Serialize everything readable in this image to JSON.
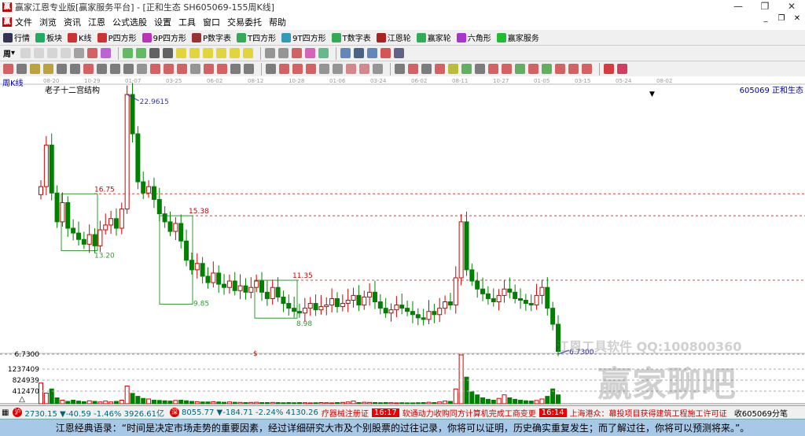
{
  "window": {
    "title": "赢家江恩专业版[赢家服务平台] - [正和生态  SH605069-155周K线]",
    "min": "—",
    "max": "❐",
    "close": "✕"
  },
  "menu": [
    "文件",
    "浏览",
    "资讯",
    "江恩",
    "公式选股",
    "设置",
    "工具",
    "窗口",
    "交易委托",
    "帮助"
  ],
  "toolbar1": [
    {
      "label": "行情",
      "color": "#335"
    },
    {
      "label": "板块",
      "color": "#2a6"
    },
    {
      "label": "K线",
      "color": "#c33"
    },
    {
      "label": "P四方形",
      "color": "#c33"
    },
    {
      "label": "9P四方形",
      "color": "#b3b"
    },
    {
      "label": "P数字表",
      "color": "#933"
    },
    {
      "label": "T四方形",
      "color": "#3a5"
    },
    {
      "label": "9T四方形",
      "color": "#39b"
    },
    {
      "label": "T数字表",
      "color": "#3a5"
    },
    {
      "label": "江恩轮",
      "color": "#a22"
    },
    {
      "label": "赢家轮",
      "color": "#3a5"
    },
    {
      "label": "六角形",
      "color": "#a3c"
    },
    {
      "label": "赢家服务",
      "color": "#2b3"
    }
  ],
  "toolbar2_period": "周",
  "chart_header": {
    "period": "周K线",
    "indicator": "老子十二宫结构",
    "stock": "605069  正和生态"
  },
  "chart_data": {
    "type": "candlestick",
    "title": "老子十二宫结构",
    "x_tick_labels": [
      "08-20",
      "10-29",
      "01-07",
      "03-25",
      "06-02",
      "08-12",
      "10-28",
      "01-06",
      "03-24",
      "06-02",
      "08-11",
      "10-27",
      "01-05",
      "03-15",
      "05-24",
      "08-02"
    ],
    "ylim": [
      6.0,
      23.5
    ],
    "closes": [
      17.2,
      19.8,
      16.8,
      15.0,
      16.2,
      14.6,
      14.3,
      13.9,
      13.6,
      14.2,
      13.5,
      14.5,
      14.8,
      15.2,
      14.6,
      15.8,
      22.96,
      20.5,
      17.5,
      16.8,
      17.2,
      16.4,
      15.5,
      15.0,
      14.4,
      14.9,
      13.8,
      12.6,
      12.0,
      12.4,
      11.6,
      11.2,
      11.8,
      11.1,
      10.9,
      11.3,
      10.7,
      11.0,
      10.6,
      10.9,
      11.3,
      10.6,
      10.2,
      10.9,
      10.3,
      9.9,
      9.6,
      9.4,
      9.3,
      9.6,
      9.9,
      9.5,
      9.7,
      9.8,
      10.2,
      9.7,
      9.9,
      10.1,
      10.4,
      9.8,
      10.3,
      10.6,
      10.0,
      9.6,
      9.3,
      9.5,
      9.8,
      9.6,
      9.4,
      9.2,
      9.0,
      8.9,
      9.4,
      9.2,
      9.6,
      10.0,
      9.8,
      11.5,
      15.0,
      12.0,
      11.3,
      10.8,
      10.5,
      10.2,
      10.0,
      10.4,
      10.8,
      10.6,
      10.2,
      10.1,
      9.9,
      9.8,
      10.4,
      10.9,
      9.6,
      8.6,
      6.9
    ],
    "volumes": [
      700000,
      360000,
      500000,
      200000,
      120000,
      80000,
      120000,
      90000,
      70000,
      100000,
      80000,
      60000,
      90000,
      60000,
      80000,
      120000,
      600000,
      350000,
      250000,
      180000,
      160000,
      120000,
      110000,
      100000,
      90000,
      110000,
      120000,
      100000,
      80000,
      70000,
      60000,
      60000,
      70000,
      60000,
      50000,
      60000,
      50000,
      45000,
      40000,
      45000,
      50000,
      40000,
      40000,
      45000,
      40000,
      35000,
      40000,
      35000,
      40000,
      35000,
      30000,
      35000,
      40000,
      35000,
      30000,
      40000,
      45000,
      60000,
      90000,
      40000,
      50000,
      45000,
      40000,
      35000,
      40000,
      35000,
      30000,
      35000,
      30000,
      30000,
      35000,
      40000,
      50000,
      40000,
      60000,
      90000,
      80000,
      500000,
      1650000,
      900000,
      400000,
      300000,
      200000,
      150000,
      120000,
      180000,
      300000,
      200000,
      150000,
      120000,
      100000,
      90000,
      110000,
      160000,
      250000,
      500000,
      300000
    ],
    "y_labels": {
      "price_low": "6.7300",
      "vol": [
        "1237409",
        "824939",
        "412470"
      ]
    },
    "annotations": {
      "high": "22.9615",
      "low": "6.7300",
      "levels": [
        "16.75",
        "13.20",
        "15.38",
        "9.85",
        "11.35",
        "8.98"
      ],
      "dollar": "$"
    },
    "colors": {
      "up": "#d00000",
      "down": "#008000"
    }
  },
  "watermark": {
    "line1": "江恩工具软件  QQ:100800360",
    "line2": "赢家聊吧"
  },
  "status": {
    "sh": "2730.15 ▼-40.59 -1.46% 3926.61亿",
    "sz": "8055.77 ▼-184.71 -2.24% 4130.26",
    "n0": "疗器械注册证",
    "t1": "16:17",
    "n1": "软通动力收购同方计算机完成工商变更",
    "t2": "16:14",
    "n2": "上海港众：幕投项目获得建筑工程施工许可证",
    "right": "收605069分笔",
    "sh_badge": "沪",
    "sz_badge": "深"
  },
  "quote": "江恩经典语录：“时间是决定市场走势的重要因素，经过详细研究大市及个别股票的过往记录，你将可以证明，历史确实重复发生；而了解过往，你将可以预测将来。”。"
}
